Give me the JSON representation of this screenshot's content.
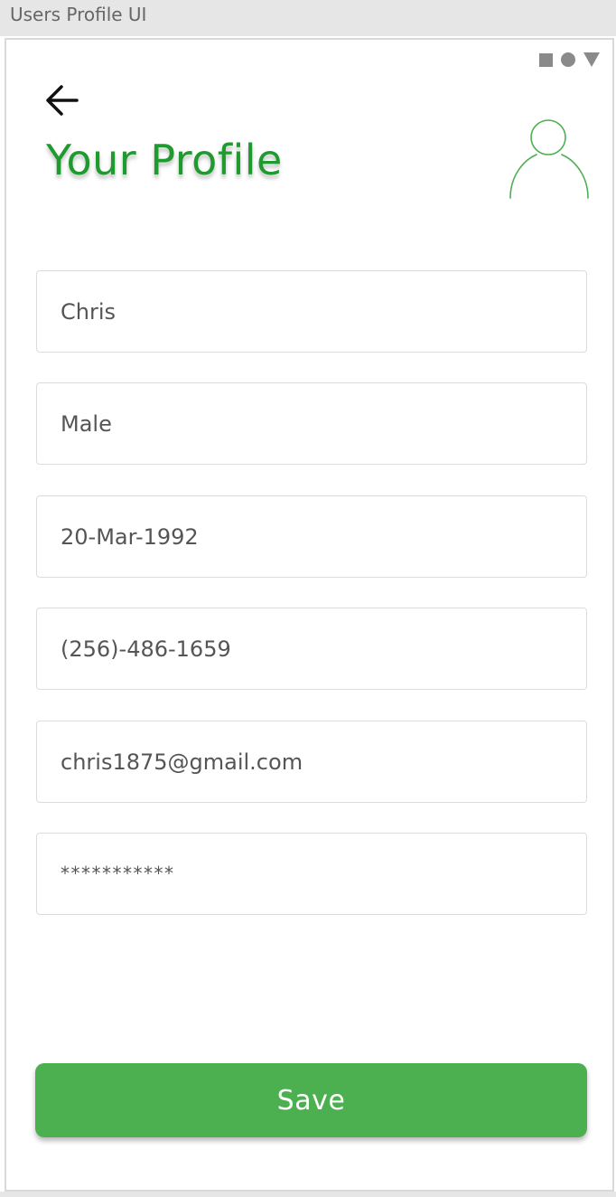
{
  "window": {
    "title": "Users Profile UI"
  },
  "status_bar": {
    "icons": [
      "square-icon",
      "circle-icon",
      "triangle-icon"
    ]
  },
  "header": {
    "back_icon": "arrow-left-icon",
    "title": "Your Profile",
    "avatar_icon": "user-outline-icon"
  },
  "form": {
    "fields": [
      {
        "name": "name",
        "value": "Chris"
      },
      {
        "name": "gender",
        "value": "Male"
      },
      {
        "name": "birth-date",
        "value": "20-Mar-1992"
      },
      {
        "name": "phone",
        "value": "(256)-486-1659"
      },
      {
        "name": "email",
        "value": "chris1875@gmail.com"
      },
      {
        "name": "password",
        "value": "***********"
      }
    ]
  },
  "actions": {
    "save_label": "Save"
  },
  "colors": {
    "accent_green": "#1f9a2e",
    "button_green": "#4caf50",
    "avatar_stroke": "#4caf50",
    "border": "#dcdcdc"
  }
}
